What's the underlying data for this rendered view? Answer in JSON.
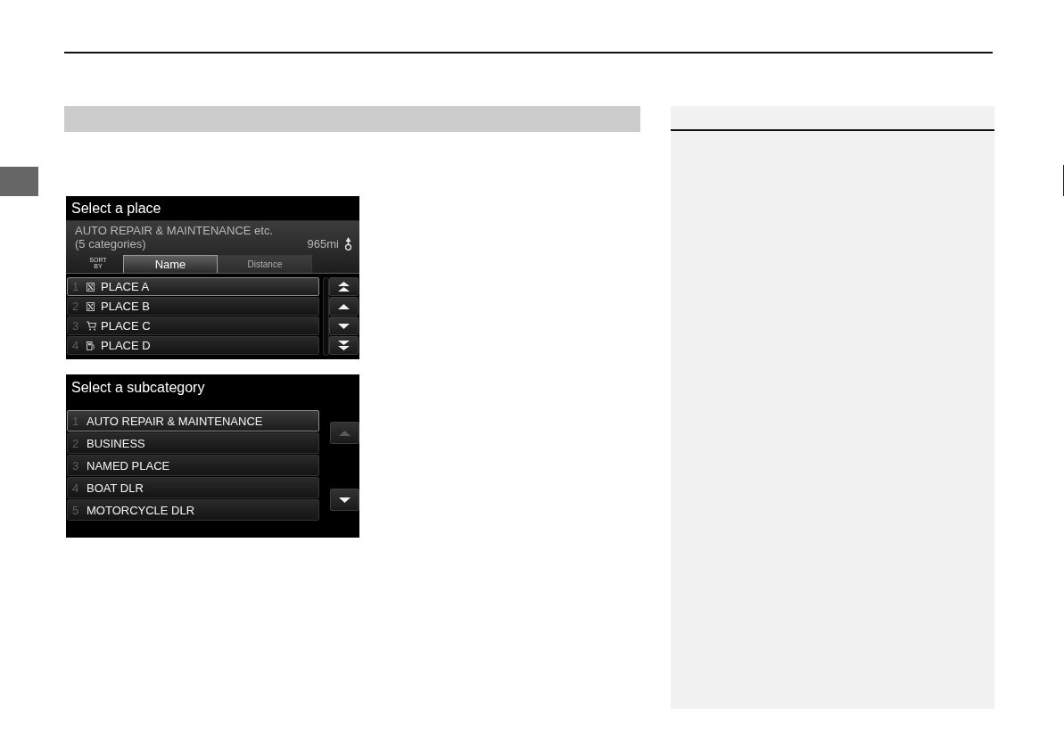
{
  "screens": [
    {
      "kind": "place_list",
      "title": "Select a place",
      "summary": {
        "categories": "AUTO REPAIR & MAINTENANCE etc.",
        "count": "(5 categories)",
        "distance": "965mi"
      },
      "sort": {
        "label": "SORT BY",
        "tabs": [
          {
            "label": "Name",
            "selected": true
          },
          {
            "label": "Distance",
            "selected": false
          }
        ]
      },
      "rows": [
        {
          "number": "1",
          "kind": "repair",
          "name": "PLACE A",
          "selected": true
        },
        {
          "number": "2",
          "kind": "repair",
          "name": "PLACE B",
          "selected": false
        },
        {
          "number": "3",
          "kind": "shopping",
          "name": "PLACE C",
          "selected": false
        },
        {
          "number": "4",
          "kind": "fuel",
          "name": "PLACE D",
          "selected": false
        }
      ],
      "scroll_buttons": [
        {
          "kind": "page_up",
          "disabled": false
        },
        {
          "kind": "up",
          "disabled": false
        },
        {
          "kind": "down",
          "disabled": false
        },
        {
          "kind": "page_down",
          "disabled": false
        }
      ]
    },
    {
      "kind": "subcategory_list",
      "title": "Select a subcategory",
      "rows": [
        {
          "number": "1",
          "name": "AUTO REPAIR & MAINTENANCE",
          "selected": true
        },
        {
          "number": "2",
          "name": "BUSINESS",
          "selected": false
        },
        {
          "number": "3",
          "name": "NAMED PLACE",
          "selected": false
        },
        {
          "number": "4",
          "name": "BOAT DLR",
          "selected": false
        },
        {
          "number": "5",
          "name": "MOTORCYCLE DLR",
          "selected": false
        }
      ],
      "scroll_buttons": [
        {
          "kind": "up",
          "disabled": true
        },
        {
          "kind": "down",
          "disabled": false
        }
      ]
    }
  ]
}
